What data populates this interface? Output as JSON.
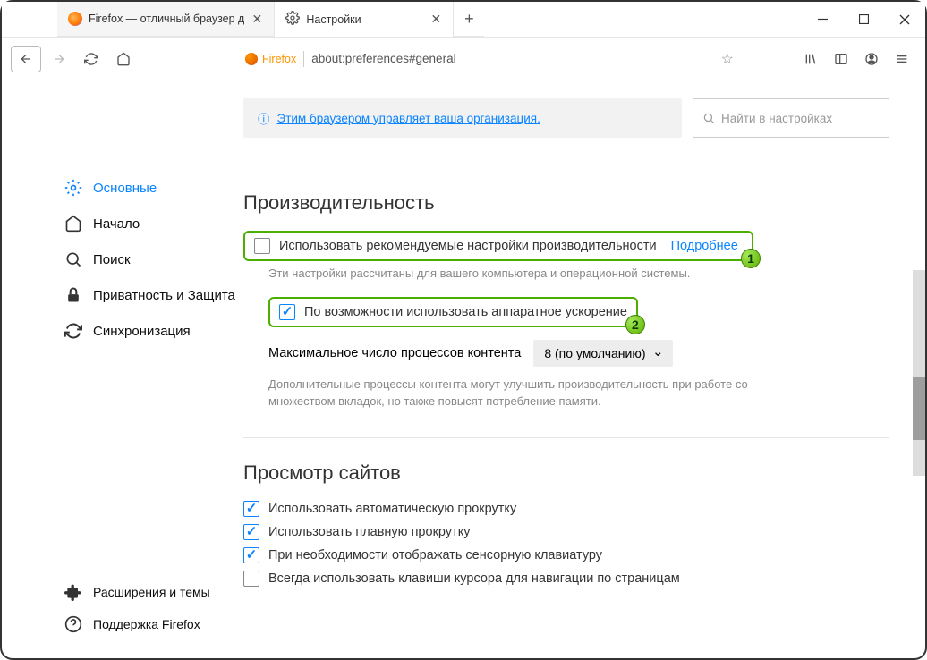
{
  "tabs": [
    {
      "title": "Firefox — отличный браузер д"
    },
    {
      "title": "Настройки"
    }
  ],
  "url": "about:preferences#general",
  "brand": "Firefox",
  "sidebar": {
    "items": [
      {
        "label": "Основные"
      },
      {
        "label": "Начало"
      },
      {
        "label": "Поиск"
      },
      {
        "label": "Приватность и Защита"
      },
      {
        "label": "Синхронизация"
      }
    ],
    "bottom": [
      {
        "label": "Расширения и темы"
      },
      {
        "label": "Поддержка Firefox"
      }
    ]
  },
  "notice": "Этим браузером управляет ваша организация.",
  "search_placeholder": "Найти в настройках",
  "perf": {
    "title": "Производительность",
    "opt1": "Использовать рекомендуемые настройки производительности",
    "opt1_link": "Подробнее",
    "opt1_desc": "Эти настройки рассчитаны для вашего компьютера и операционной системы.",
    "opt2": "По возможности использовать аппаратное ускорение",
    "proc_label": "Максимальное число процессов контента",
    "proc_value": "8 (по умолчанию)",
    "proc_desc": "Дополнительные процессы контента могут улучшить производительность при работе со множеством вкладок, но также повысят потребление памяти."
  },
  "browsing": {
    "title": "Просмотр сайтов",
    "opts": [
      {
        "label": "Использовать автоматическую прокрутку",
        "checked": true
      },
      {
        "label": "Использовать плавную прокрутку",
        "checked": true
      },
      {
        "label": "При необходимости отображать сенсорную клавиатуру",
        "checked": true
      },
      {
        "label": "Всегда использовать клавиши курсора для навигации по страницам",
        "checked": false
      }
    ]
  }
}
